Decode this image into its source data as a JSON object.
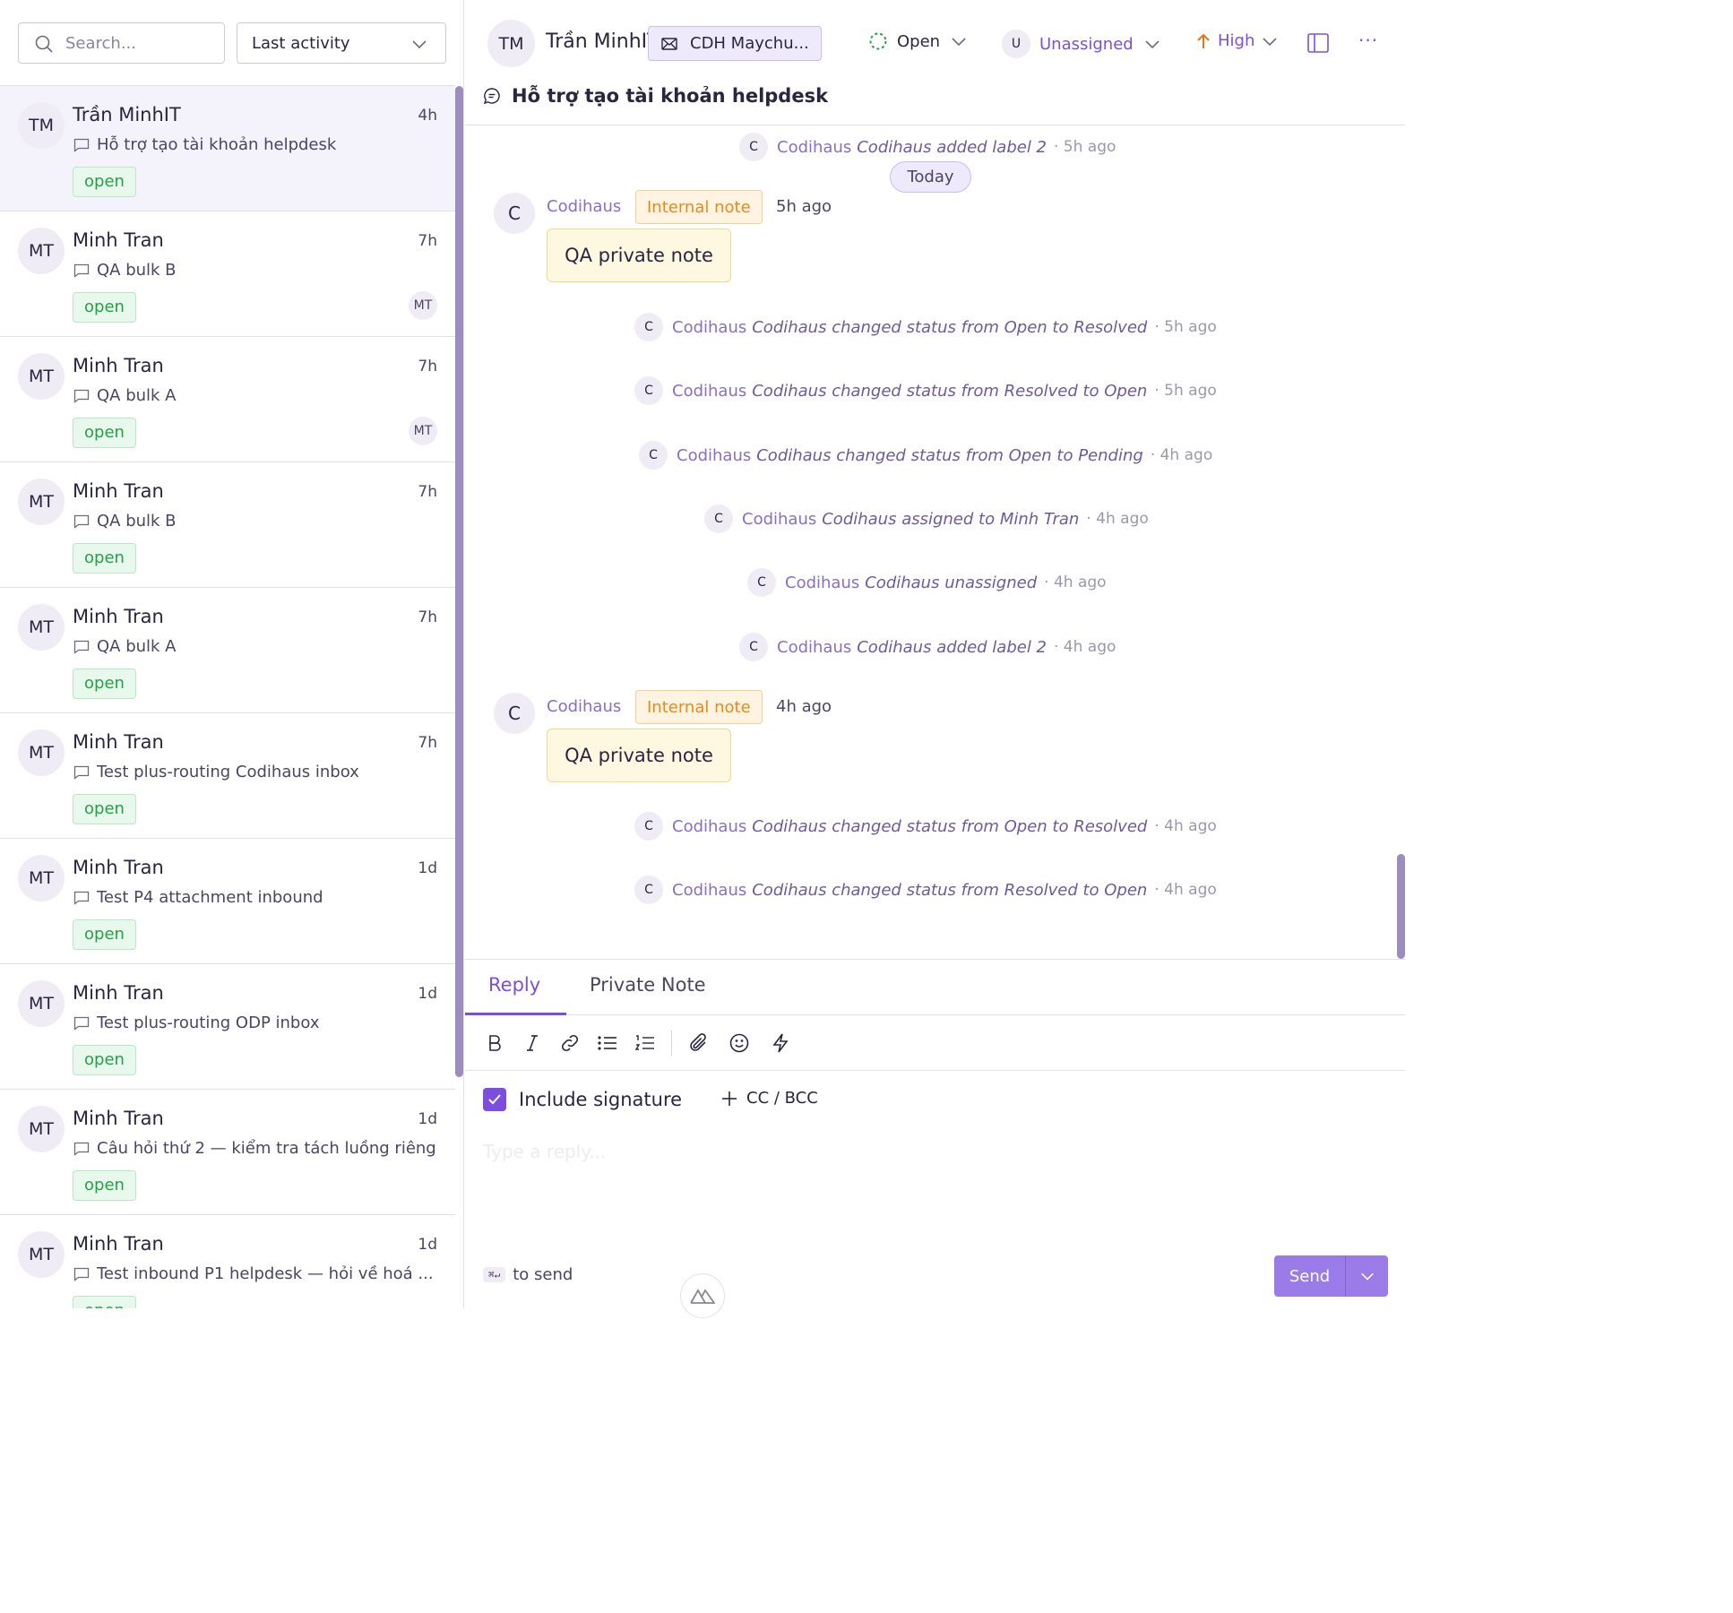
{
  "sidebar": {
    "search_placeholder": "Search...",
    "sort_label": "Last activity",
    "conversations": [
      {
        "initials": "TM",
        "name": "Trần MinhIT",
        "time": "4h",
        "subject": "Hỗ trợ tạo tài khoản helpdesk",
        "status": "open",
        "assignee": ""
      },
      {
        "initials": "MT",
        "name": "Minh Tran",
        "time": "7h",
        "subject": "QA bulk B",
        "status": "open",
        "assignee": "MT"
      },
      {
        "initials": "MT",
        "name": "Minh Tran",
        "time": "7h",
        "subject": "QA bulk A",
        "status": "open",
        "assignee": "MT"
      },
      {
        "initials": "MT",
        "name": "Minh Tran",
        "time": "7h",
        "subject": "QA bulk B",
        "status": "open",
        "assignee": ""
      },
      {
        "initials": "MT",
        "name": "Minh Tran",
        "time": "7h",
        "subject": "QA bulk A",
        "status": "open",
        "assignee": ""
      },
      {
        "initials": "MT",
        "name": "Minh Tran",
        "time": "7h",
        "subject": "Test plus-routing Codihaus inbox",
        "status": "open",
        "assignee": ""
      },
      {
        "initials": "MT",
        "name": "Minh Tran",
        "time": "1d",
        "subject": "Test P4 attachment inbound",
        "status": "open",
        "assignee": ""
      },
      {
        "initials": "MT",
        "name": "Minh Tran",
        "time": "1d",
        "subject": "Test plus-routing ODP inbox",
        "status": "open",
        "assignee": ""
      },
      {
        "initials": "MT",
        "name": "Minh Tran",
        "time": "1d",
        "subject": "Câu hỏi thứ 2 — kiểm tra tách luồng riêng",
        "status": "open",
        "assignee": ""
      },
      {
        "initials": "MT",
        "name": "Minh Tran",
        "time": "1d",
        "subject": "Test inbound P1 helpdesk — hỏi về hoá ...",
        "status": "open",
        "assignee": ""
      }
    ]
  },
  "header": {
    "contact_initials": "TM",
    "contact_name": "Trần MinhIT",
    "inbox_label": "CDH Maychu...",
    "status_label": "Open",
    "assignee_initial": "U",
    "assignee_label": "Unassigned",
    "priority_label": "High",
    "more_label": "···",
    "conversation_title": "Hỗ trợ tạo tài khoản helpdesk"
  },
  "thread": {
    "today_label": "Today",
    "activities": [
      {
        "avatar": "C",
        "actor": "Codihaus",
        "text": "Codihaus added label 2",
        "ago": "· 5h ago"
      },
      {
        "avatar": "C",
        "actor": "Codihaus",
        "text": "Codihaus changed status from Open to Resolved",
        "ago": "· 5h ago"
      },
      {
        "avatar": "C",
        "actor": "Codihaus",
        "text": "Codihaus changed status from Resolved to Open",
        "ago": "· 5h ago"
      },
      {
        "avatar": "C",
        "actor": "Codihaus",
        "text": "Codihaus changed status from Open to Pending",
        "ago": "· 4h ago"
      },
      {
        "avatar": "C",
        "actor": "Codihaus",
        "text": "Codihaus assigned to Minh Tran",
        "ago": "· 4h ago"
      },
      {
        "avatar": "C",
        "actor": "Codihaus",
        "text": "Codihaus unassigned",
        "ago": "· 4h ago"
      },
      {
        "avatar": "C",
        "actor": "Codihaus",
        "text": "Codihaus added label 2",
        "ago": "· 4h ago"
      },
      {
        "avatar": "C",
        "actor": "Codihaus",
        "text": "Codihaus changed status from Open to Resolved",
        "ago": "· 4h ago"
      },
      {
        "avatar": "C",
        "actor": "Codihaus",
        "text": "Codihaus changed status from Resolved to Open",
        "ago": "· 4h ago"
      }
    ],
    "notes": [
      {
        "avatar": "C",
        "sender": "Codihaus",
        "tag": "Internal note",
        "time": "5h ago",
        "body": "QA private note"
      },
      {
        "avatar": "C",
        "sender": "Codihaus",
        "tag": "Internal note",
        "time": "4h ago",
        "body": "QA private note"
      }
    ]
  },
  "composer": {
    "tab_reply": "Reply",
    "tab_private_note": "Private Note",
    "include_signature": "Include signature",
    "cc_bcc": "CC / BCC",
    "reply_placeholder": "Type a reply...",
    "kbd_hint": "⌘↵",
    "send_hint": "to send",
    "send_label": "Send"
  },
  "colors": {
    "accent": "#7b4ee0",
    "open_green": "#27a048",
    "note_orange": "#e88a1a",
    "priority_high": "#e8731a"
  }
}
